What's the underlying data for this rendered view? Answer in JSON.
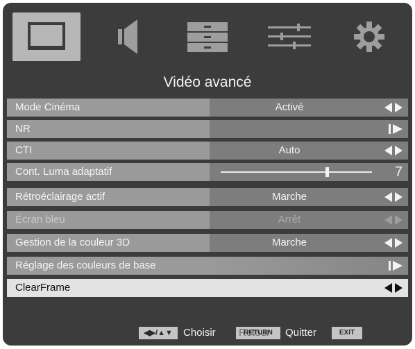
{
  "menu": {
    "title": "Vidéo avancé",
    "tabs": [
      {
        "icon": "tv-screen-icon",
        "selected": true
      },
      {
        "icon": "speaker-icon",
        "selected": false
      },
      {
        "icon": "list-icon",
        "selected": false
      },
      {
        "icon": "sliders-icon",
        "selected": false
      },
      {
        "icon": "gear-icon",
        "selected": false
      }
    ],
    "rows": [
      {
        "label": "Mode Cinéma",
        "value": "Activé",
        "control": "left-right-arrows"
      },
      {
        "label": "NR",
        "value": "",
        "control": "enter-arrow"
      },
      {
        "label": "CTI",
        "value": "Auto",
        "control": "left-right-arrows"
      },
      {
        "label": "Cont. Luma adaptatif",
        "value": "7",
        "control": "slider",
        "level": 7,
        "min": 0,
        "max": 10
      },
      {
        "label": "Rétroéclairage actif",
        "value": "Marche",
        "control": "left-right-arrows"
      },
      {
        "label": "Écran bleu",
        "value": "Arrêt",
        "control": "left-right-arrows",
        "disabled": true
      },
      {
        "label": "Gestion de la couleur 3D",
        "value": "Marche",
        "control": "left-right-arrows"
      },
      {
        "label": "Réglage des couleurs de base",
        "value": "",
        "control": "enter-arrow"
      },
      {
        "label": "ClearFrame",
        "value": "",
        "control": "left-right-arrows",
        "highlighted": true
      }
    ]
  },
  "footer": {
    "nav_symbol": "◀▶/▲▼",
    "choose_label": "Choisir",
    "return_key": "RETURN",
    "return_label": "Retour",
    "quit_label": "Quitter",
    "exit_key": "EXIT"
  },
  "colors": {
    "background": "#3c3c3c",
    "row_label": "#9a9a9a",
    "row_value": "#7d7d7d",
    "highlight": "#e3e3e3"
  }
}
